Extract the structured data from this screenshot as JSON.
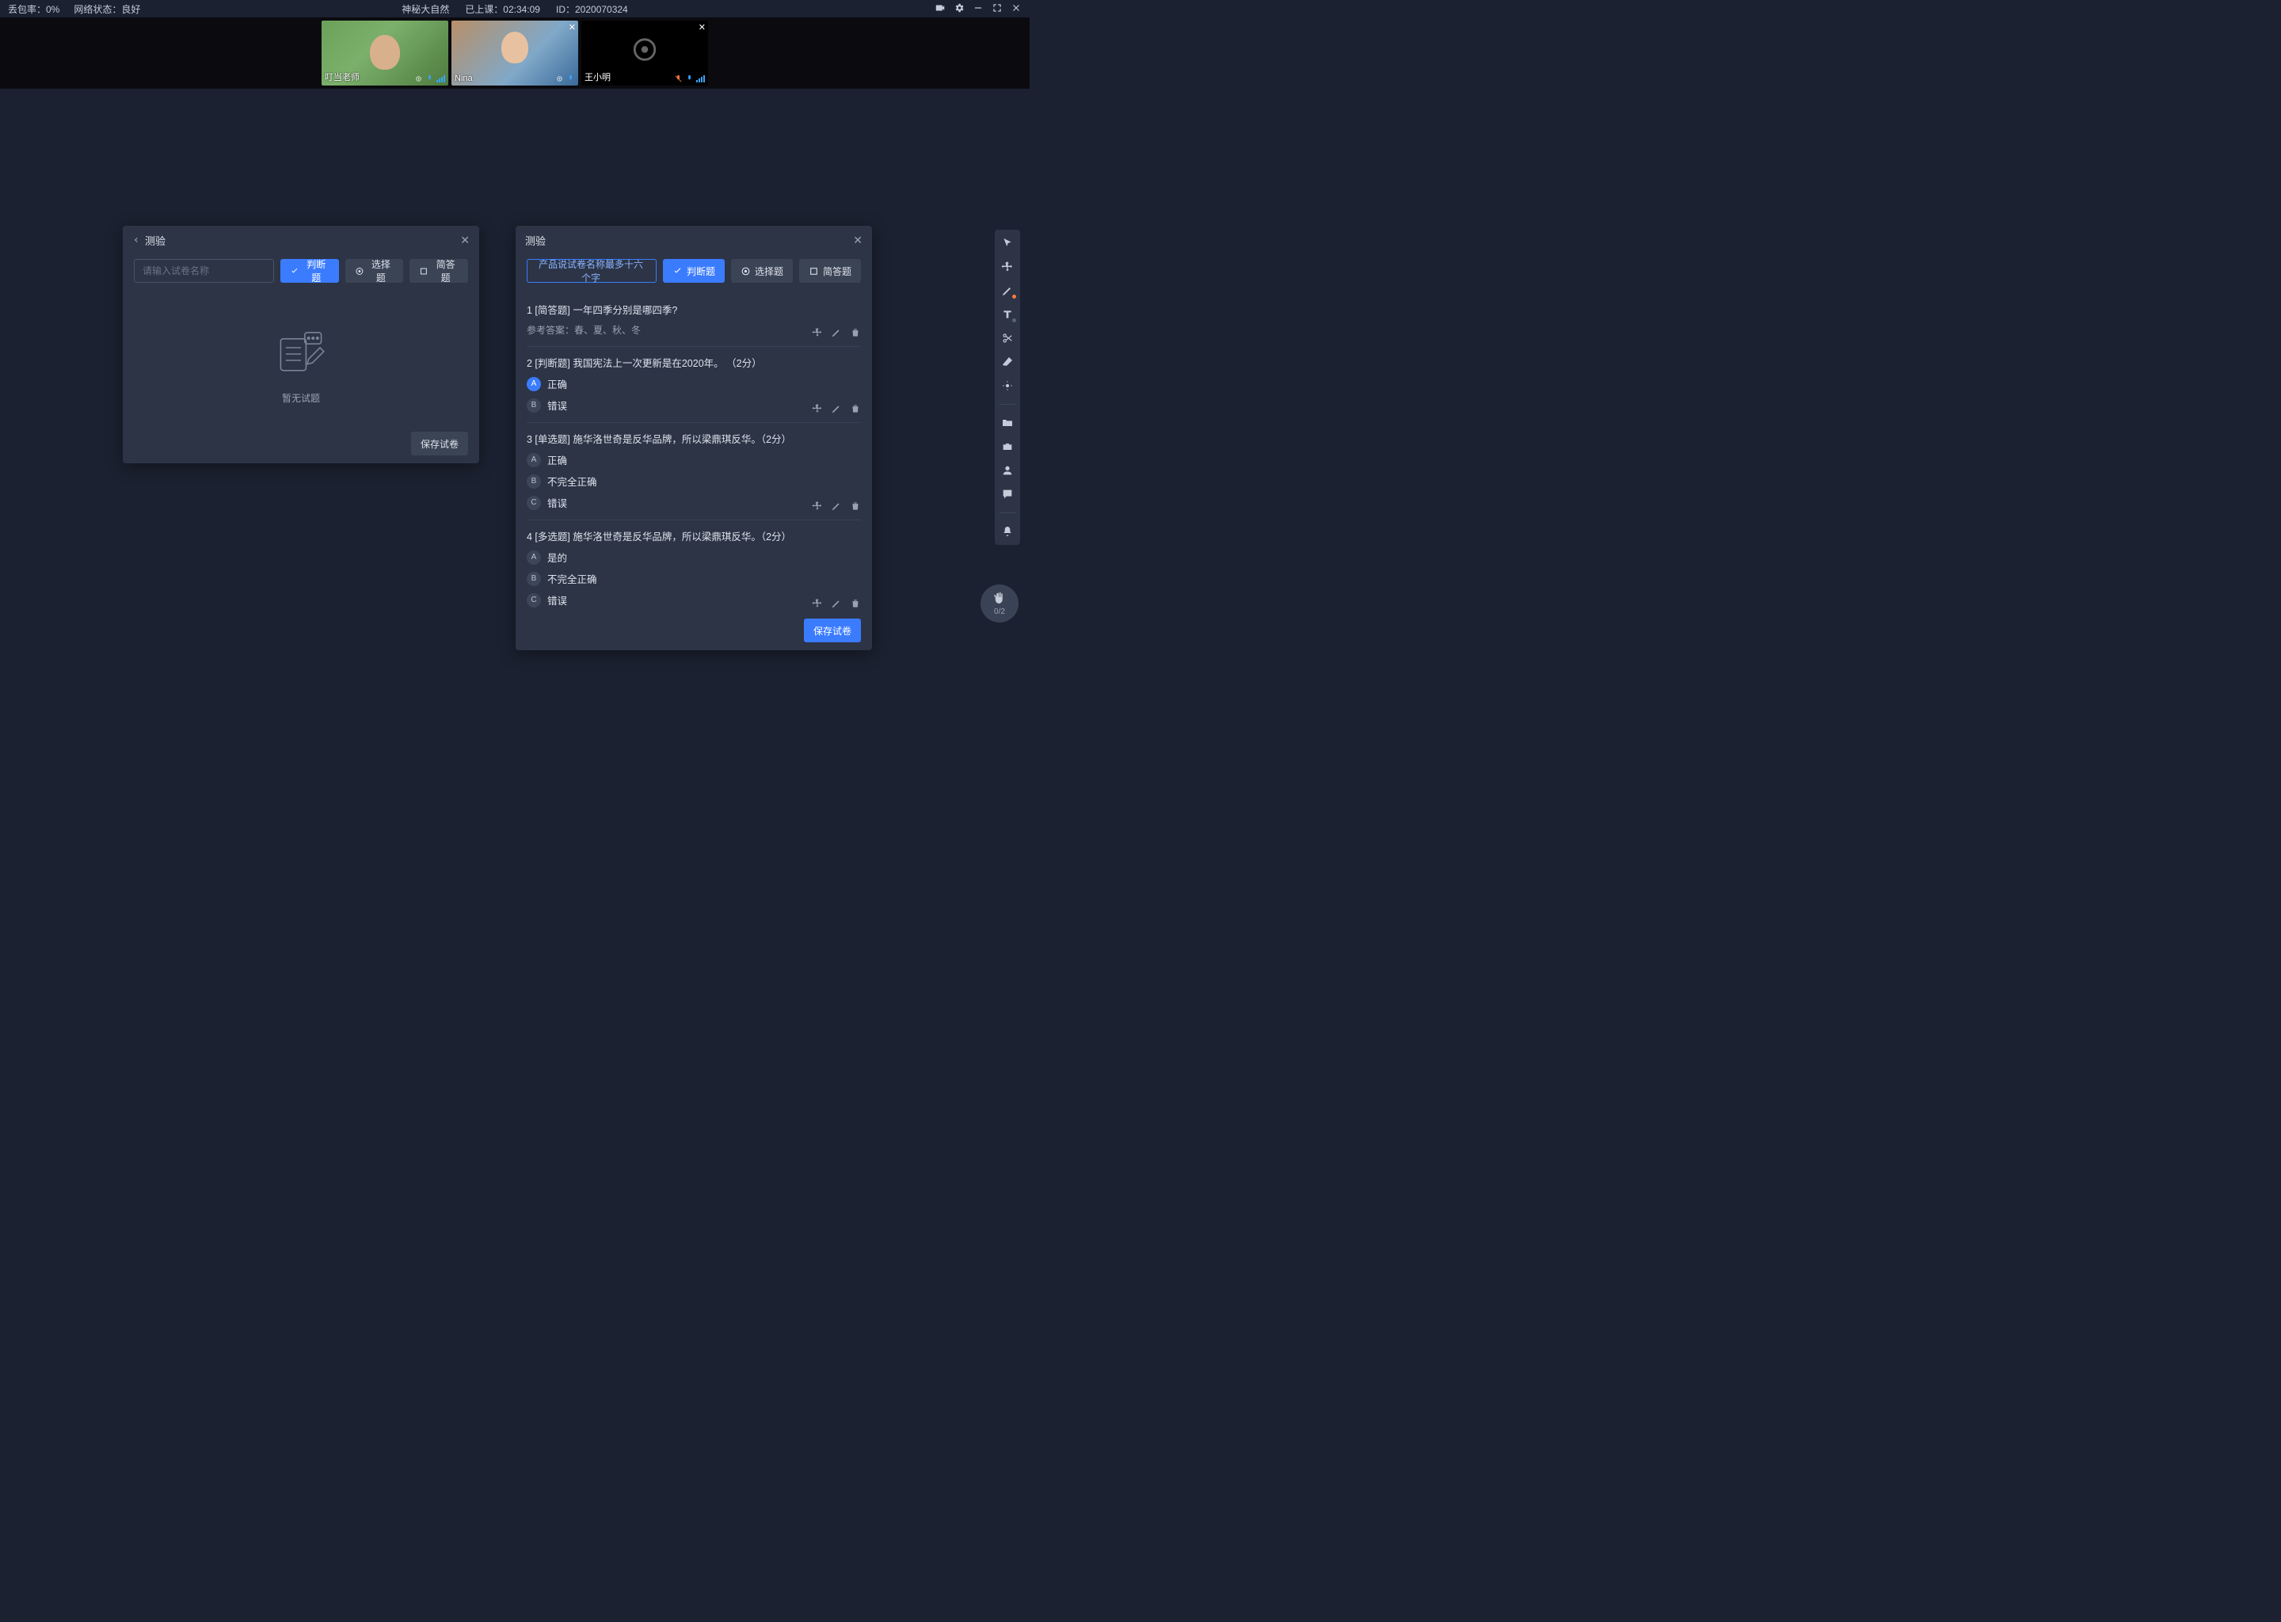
{
  "topbar": {
    "loss_rate_label": "丢包率：0%",
    "network_label": "网络状态：良好",
    "course_title": "神秘大自然",
    "elapsed_label": "已上课：02:34:09",
    "id_label": "ID：2020070324"
  },
  "videos": [
    {
      "name": "叮当老师",
      "has_close": false,
      "camera_off": false,
      "bg": "1"
    },
    {
      "name": "Nina",
      "has_close": true,
      "camera_off": false,
      "bg": "2"
    },
    {
      "name": "王小明",
      "has_close": true,
      "camera_off": true,
      "bg": "dark"
    }
  ],
  "panel_left": {
    "title": "测验",
    "placeholder": "请输入试卷名称",
    "btn_tf": "判断题",
    "btn_choice": "选择题",
    "btn_short": "简答题",
    "empty_text": "暂无试题",
    "save": "保存试卷"
  },
  "panel_right": {
    "title": "测验",
    "name_value": "产品说试卷名称最多十六个字",
    "btn_tf": "判断题",
    "btn_choice": "选择题",
    "btn_short": "简答题",
    "save": "保存试卷",
    "questions": [
      {
        "header": "1 [简答题] 一年四季分别是哪四季?",
        "answer_label": "参考答案：春、夏、秋、冬",
        "options": []
      },
      {
        "header": "2 [判断题] 我国宪法上一次更新是在2020年。 （2分）",
        "options": [
          {
            "letter": "A",
            "text": "正确",
            "selected": true
          },
          {
            "letter": "B",
            "text": "错误",
            "selected": false
          }
        ]
      },
      {
        "header": "3 [单选题] 施华洛世奇是反华品牌，所以梁鼎琪反华。（2分）",
        "options": [
          {
            "letter": "A",
            "text": "正确",
            "selected": false
          },
          {
            "letter": "B",
            "text": "不完全正确",
            "selected": false
          },
          {
            "letter": "C",
            "text": "错误",
            "selected": false
          }
        ]
      },
      {
        "header": "4 [多选题] 施华洛世奇是反华品牌，所以梁鼎琪反华。（2分）",
        "options": [
          {
            "letter": "A",
            "text": "是的",
            "selected": false
          },
          {
            "letter": "B",
            "text": "不完全正确",
            "selected": false
          },
          {
            "letter": "C",
            "text": "错误",
            "selected": false
          }
        ]
      }
    ]
  },
  "hand": {
    "count": "0/2"
  }
}
